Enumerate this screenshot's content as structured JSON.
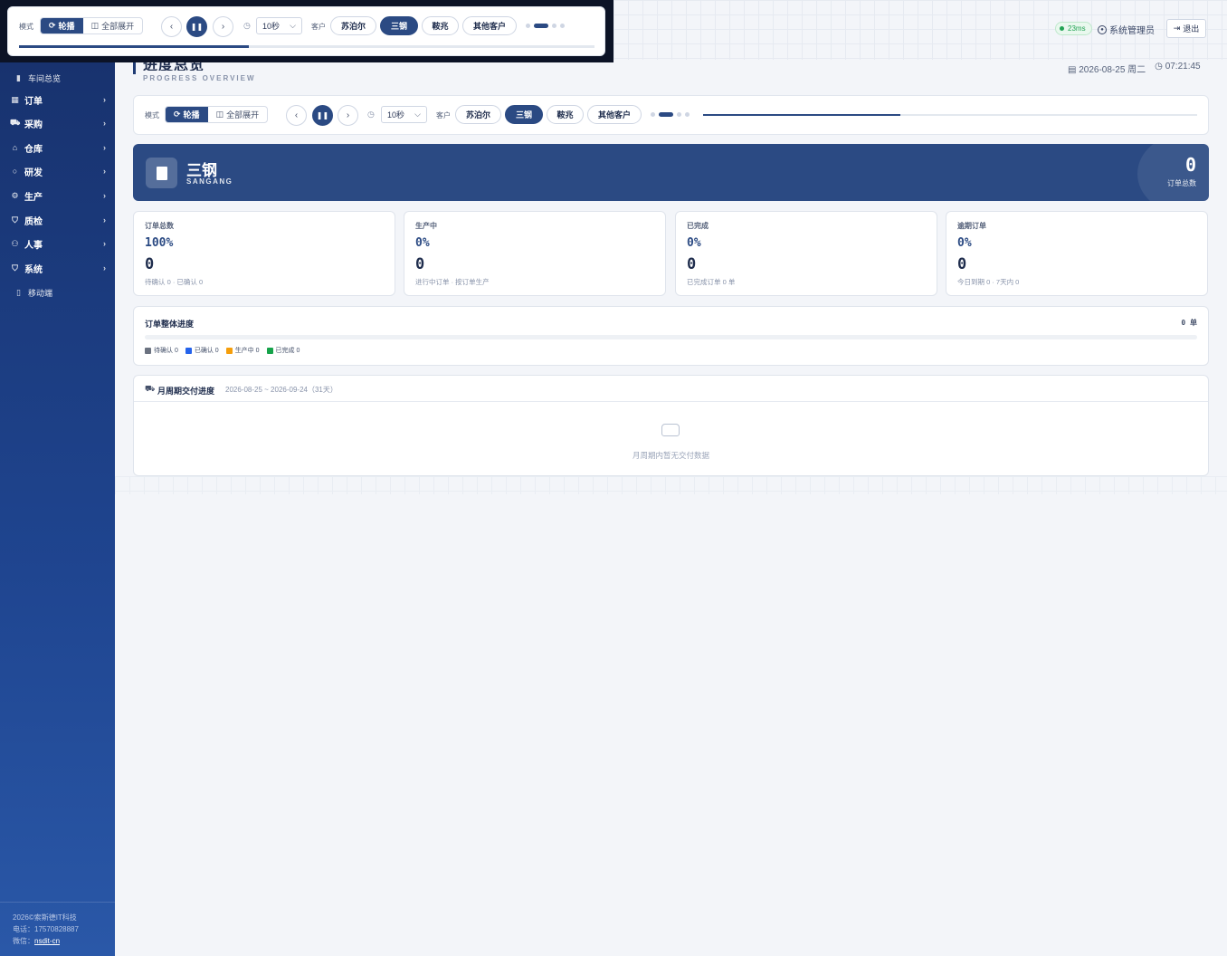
{
  "sidebar": {
    "items": [
      {
        "label": "车间总览",
        "icon": "file-icon",
        "sub": true
      },
      {
        "label": "订单",
        "icon": "table-icon"
      },
      {
        "label": "采购",
        "icon": "cart-icon"
      },
      {
        "label": "仓库",
        "icon": "home-icon"
      },
      {
        "label": "研发",
        "icon": "bulb-icon"
      },
      {
        "label": "生产",
        "icon": "gear-icon"
      },
      {
        "label": "质检",
        "icon": "shield-icon"
      },
      {
        "label": "人事",
        "icon": "users-icon"
      },
      {
        "label": "系统",
        "icon": "shield-icon"
      },
      {
        "label": "移动端",
        "icon": "phone-icon",
        "sub": true
      }
    ],
    "footer": {
      "copyright": "2026©索斯德IT科技",
      "phone": "电话：17570828887",
      "wechat_label": "微信：",
      "wechat": "nsdit-cn"
    }
  },
  "header": {
    "ping": "23ms",
    "user": "系统管理员",
    "logout": "退出"
  },
  "page": {
    "title": "进度总览",
    "subtitle": "PROGRESS OVERVIEW",
    "date": "2026-08-25 周二",
    "time": "07:21:45"
  },
  "controls": {
    "mode_label": "模式",
    "mode_carousel": "轮播",
    "mode_expand": "全部展开",
    "interval": "10秒",
    "customer_label": "客户",
    "customers": [
      "苏泊尔",
      "三钢",
      "鞍兆",
      "其他客户"
    ],
    "active_customer": "三钢",
    "carousel_progress": 0.4
  },
  "banner": {
    "name": "三钢",
    "code": "SANGANG",
    "total": "0",
    "total_label": "订单总数"
  },
  "cards": [
    {
      "label": "订单总数",
      "pct": "100%",
      "value": "0",
      "note": "待确认 0 · 已确认 0"
    },
    {
      "label": "生产中",
      "pct": "0%",
      "value": "0",
      "note": "进行中订单 · 按订单生产"
    },
    {
      "label": "已完成",
      "pct": "0%",
      "value": "0",
      "note": "已完成订单 0 单"
    },
    {
      "label": "逾期订单",
      "pct": "0%",
      "value": "0",
      "note": "今日到期 0 · 7天内 0"
    }
  ],
  "overall": {
    "title": "订单整体进度",
    "count": "0 单",
    "legend": [
      {
        "label": "待确认 0",
        "color": "#6b7280"
      },
      {
        "label": "已确认 0",
        "color": "#2563eb"
      },
      {
        "label": "生产中 0",
        "color": "#f59e0b"
      },
      {
        "label": "已完成 0",
        "color": "#16a34a"
      }
    ]
  },
  "delivery": {
    "title": "月周期交付进度",
    "range": "2026-08-25 ~ 2026-09-24（31天）",
    "empty": "月周期内暂无交付数据"
  }
}
